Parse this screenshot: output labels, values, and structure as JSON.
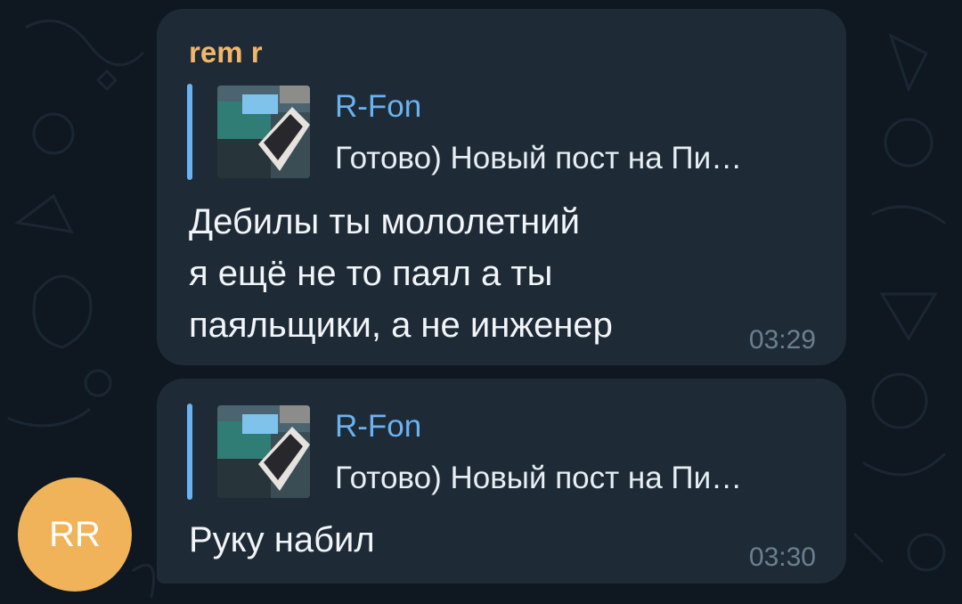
{
  "colors": {
    "background": "#0f1821",
    "bubble": "#1e2b36",
    "sender_name": "#f1b66a",
    "reply_accent": "#6ab2f2",
    "message_text": "#f2f5f8",
    "timestamp": "#6b7f90",
    "avatar": "#f0b35a"
  },
  "messages": [
    {
      "sender": "rem r",
      "reply": {
        "name": "R-Fon",
        "preview": "Готово)  Новый пост на Пи…",
        "thumbnail_icon": "photo-thumbnail-icon"
      },
      "text_lines": [
        "Дебилы ты мололетний",
        "я ещё не то паял а ты",
        "паяльщики, а не инженер"
      ],
      "time": "03:29"
    },
    {
      "reply": {
        "name": "R-Fon",
        "preview": "Готово)  Новый пост на Пи…",
        "thumbnail_icon": "photo-thumbnail-icon"
      },
      "text_lines": [
        "Руку набил"
      ],
      "time": "03:30"
    }
  ],
  "avatar": {
    "initials": "RR"
  }
}
